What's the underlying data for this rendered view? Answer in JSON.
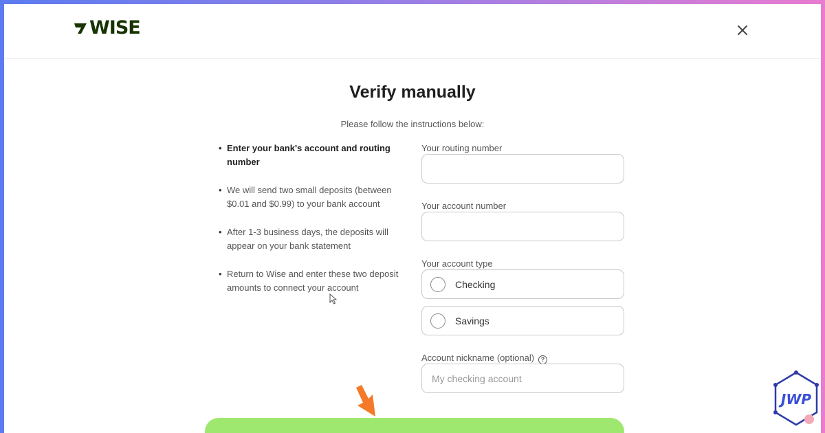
{
  "header": {
    "logo_text": "WISE",
    "brand_color": "#163300",
    "close_icon": "close-icon"
  },
  "main": {
    "title": "Verify manually",
    "subtitle": "Please follow the instructions below:",
    "instructions": [
      "Enter your bank's account and routing number",
      "We will send two small deposits (between $0.01 and $0.99) to your bank account",
      "After 1-3 business days, the deposits will appear on your bank statement",
      "Return to Wise and enter these two deposit amounts to connect your account"
    ],
    "form": {
      "routing_label": "Your routing number",
      "routing_value": "",
      "account_label": "Your account number",
      "account_value": "",
      "account_type_label": "Your account type",
      "account_type_options": [
        "Checking",
        "Savings"
      ],
      "nickname_label": "Account nickname (optional)",
      "nickname_placeholder": "My checking account",
      "help_icon": "question-circle-icon"
    },
    "submit_color": "#9fe870"
  },
  "overlay": {
    "arrow_color": "#f47a2a",
    "badge_text": "JWP"
  }
}
